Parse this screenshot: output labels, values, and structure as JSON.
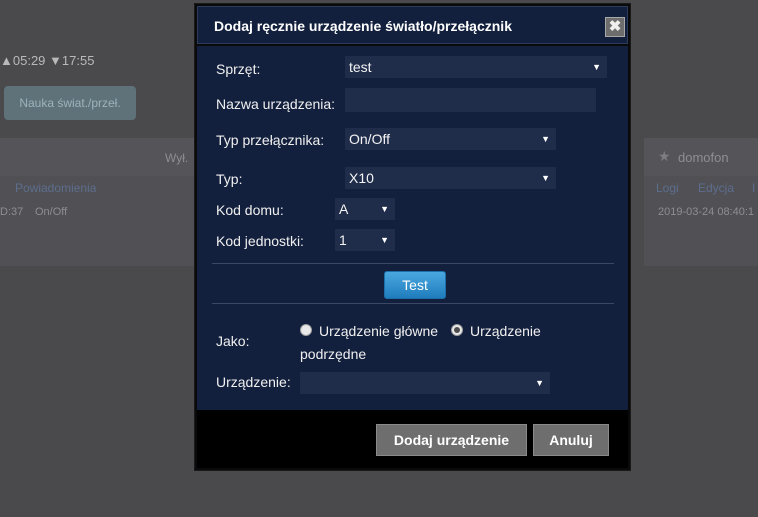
{
  "background": {
    "sun_rise": "05:29",
    "sun_set": "17:55",
    "learn_button": "Nauka świat./przeł.",
    "row_left": {
      "status": "Wył.",
      "notifications_link": "Powiadomienia",
      "time_fragment": "D:37",
      "state": "On/Off"
    },
    "row_right": {
      "name": "domofon",
      "logs_link": "Logi",
      "edit_link": "Edycja",
      "more_fragment": "I",
      "date": "2019-03-24 08:40:1"
    }
  },
  "modal": {
    "title": "Dodaj ręcznie urządzenie światło/przełącznik",
    "close_symbol": "✖",
    "fields": {
      "hardware": {
        "label": "Sprzęt:",
        "value": "test"
      },
      "device_name": {
        "label": "Nazwa urządzenia:",
        "value": ""
      },
      "switch_type": {
        "label": "Typ przełącznika:",
        "value": "On/Off"
      },
      "type": {
        "label": "Typ:",
        "value": "X10"
      },
      "house_code": {
        "label": "Kod domu:",
        "value": "A"
      },
      "unit_code": {
        "label": "Kod jednostki:",
        "value": "1"
      }
    },
    "test_button": "Test",
    "as": {
      "label": "Jako:",
      "option_main": "Urządzenie główne",
      "option_sub_line1": "Urządzenie",
      "option_sub_line2": "podrzędne",
      "selected": "sub"
    },
    "device": {
      "label": "Urządzenie:",
      "value": ""
    },
    "footer": {
      "add_button": "Dodaj urządzenie",
      "cancel_button": "Anuluj"
    }
  },
  "colors": {
    "modal_body": "#13203d",
    "field_bg": "#1f2c4a",
    "accent_button": "#2a8fd2"
  }
}
